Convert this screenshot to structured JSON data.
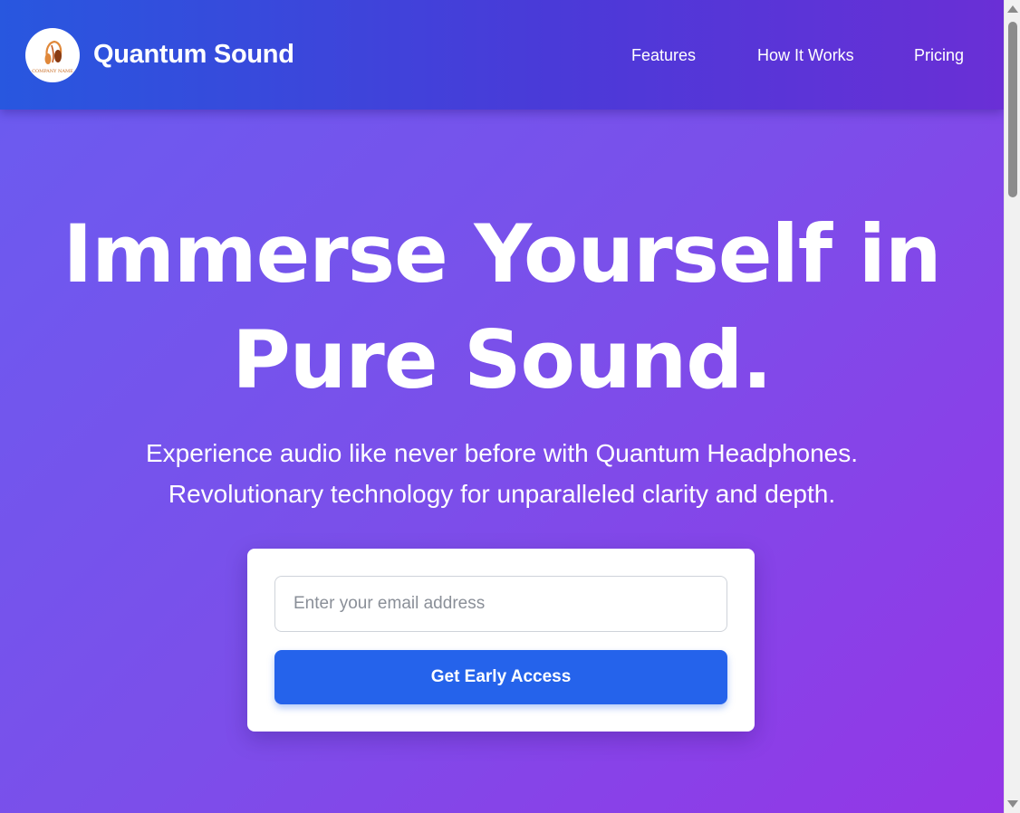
{
  "header": {
    "brand": "Quantum Sound",
    "logo_text": "COMPANY NAME",
    "nav": [
      {
        "label": "Features"
      },
      {
        "label": "How It Works"
      },
      {
        "label": "Pricing"
      }
    ]
  },
  "hero": {
    "title_line1": "Immerse Yourself in",
    "title_line2": "Pure Sound.",
    "subtitle_line1": "Experience audio like never before with Quantum Headphones.",
    "subtitle_line2": "Revolutionary technology for unparalleled clarity and depth."
  },
  "signup": {
    "email_placeholder": "Enter your email address",
    "email_value": "",
    "button_label": "Get Early Access"
  },
  "colors": {
    "header_start": "#2857df",
    "header_end": "#6a2fd6",
    "hero_start": "#6a5cf0",
    "hero_end": "#9436e6",
    "accent_button": "#2563eb"
  },
  "icons": {
    "logo": "headphones-logo-icon"
  }
}
